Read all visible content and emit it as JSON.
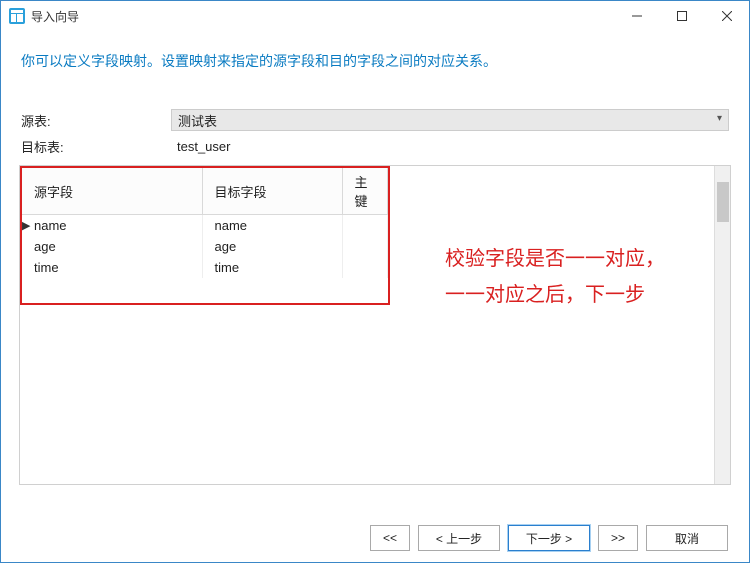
{
  "title": "导入向导",
  "description": "你可以定义字段映射。设置映射来指定的源字段和目的字段之间的对应关系。",
  "form": {
    "source_table_label": "源表:",
    "source_table_value": "测试表",
    "target_table_label": "目标表:",
    "target_table_value": "test_user"
  },
  "columns": {
    "source_field": "源字段",
    "target_field": "目标字段",
    "primary_key": "主键"
  },
  "rows": [
    {
      "source": "name",
      "target": "name",
      "pk": ""
    },
    {
      "source": "age",
      "target": "age",
      "pk": ""
    },
    {
      "source": "time",
      "target": "time",
      "pk": ""
    }
  ],
  "annotation": {
    "line1": "校验字段是否一一对应，",
    "line2": "一一对应之后，下一步"
  },
  "buttons": {
    "first": "<<",
    "prev": "< 上一步",
    "next": "下一步 >",
    "last": ">>",
    "cancel": "取消"
  }
}
